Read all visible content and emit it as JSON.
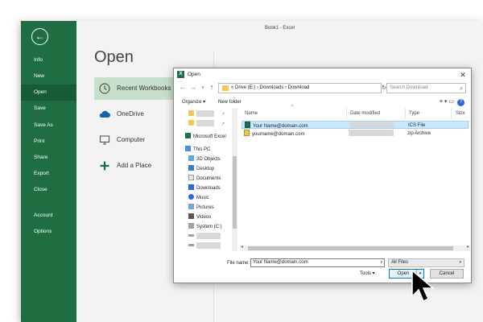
{
  "excel": {
    "window_title": "Book1 - Excel",
    "back_glyph": "←",
    "nav": [
      {
        "label": "Info"
      },
      {
        "label": "New"
      },
      {
        "label": "Open",
        "active": true
      },
      {
        "label": "Save"
      },
      {
        "label": "Save As"
      },
      {
        "label": "Print"
      },
      {
        "label": "Share"
      },
      {
        "label": "Export"
      },
      {
        "label": "Close"
      },
      {
        "label": "Account"
      },
      {
        "label": "Options"
      }
    ],
    "page_title": "Open",
    "places": [
      {
        "label": "Recent Workbooks",
        "icon": "clock-icon",
        "active": true
      },
      {
        "label": "OneDrive",
        "icon": "cloud-icon"
      },
      {
        "label": "Computer",
        "icon": "computer-icon"
      },
      {
        "label": "Add a Place",
        "icon": "plus-icon"
      }
    ]
  },
  "dialog": {
    "title": "Open",
    "app_icon_letter": "X",
    "close_glyph": "✕",
    "back_glyph": "←",
    "forward_glyph": "→",
    "down_glyph": "∨",
    "up_glyph": "↑",
    "refresh_glyph": "↻",
    "address": "« Drive (E:) › Downloads › Download",
    "search_placeholder": "Search Download",
    "search_glyph": "⌕",
    "organize_label": "Organize ▾",
    "new_folder_label": "New folder",
    "view_glyphs": "≡ ▾ ▭",
    "help_glyph": "?",
    "pin_glyph": "⭧",
    "sort_glyph": "^",
    "nav_tree": [
      {
        "label": "",
        "type": "blurred"
      },
      {
        "label": "",
        "type": "blurred"
      },
      {
        "label": "Microsoft Excel",
        "type": "excel"
      },
      {
        "label": "This PC",
        "type": "pc"
      },
      {
        "label": "3D Objects",
        "type": "cube"
      },
      {
        "label": "Desktop",
        "type": "desktop"
      },
      {
        "label": "Documents",
        "type": "doc"
      },
      {
        "label": "Downloads",
        "type": "download"
      },
      {
        "label": "Music",
        "type": "music"
      },
      {
        "label": "Pictures",
        "type": "pictures"
      },
      {
        "label": "Videos",
        "type": "videos"
      },
      {
        "label": "System (C:)",
        "type": "drive"
      },
      {
        "label": "",
        "type": "blurred"
      },
      {
        "label": "",
        "type": "blurred"
      }
    ],
    "columns": [
      {
        "label": "Name"
      },
      {
        "label": "Date modified"
      },
      {
        "label": "Type"
      },
      {
        "label": "Size"
      }
    ],
    "files": [
      {
        "name": "Your Name@domain.com",
        "date": "",
        "type": "ICS File",
        "selected": true
      },
      {
        "name": "yourname@domain.com",
        "date": "",
        "type": "zip Archive",
        "selected": false
      }
    ],
    "scroll_left_glyph": "◂",
    "scroll_right_glyph": "▸",
    "file_name_label": "File name:",
    "file_name_value": "Your Name@domain.com",
    "dropdown_glyph": "▾",
    "filter_value": "All Files",
    "tools_label": "Tools ▾",
    "open_label": "Open",
    "cancel_label": "Cancel"
  },
  "colors": {
    "excel_green": "#1e6e42",
    "excel_green_active": "#185c37",
    "selection": "#cce8ff",
    "folder": "#f5c652"
  }
}
